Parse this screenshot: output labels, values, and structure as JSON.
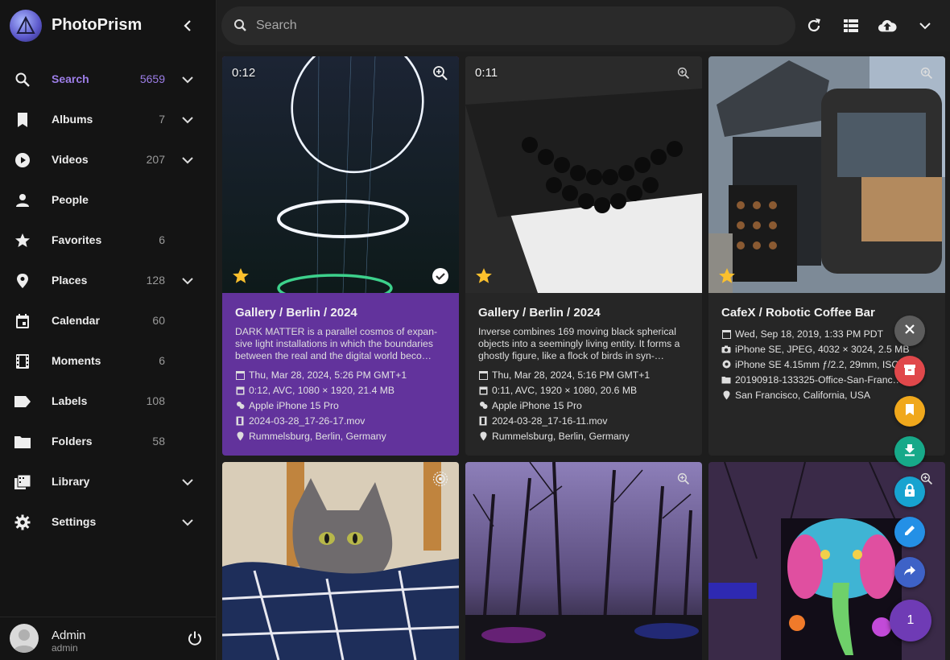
{
  "app": {
    "title": "PhotoPrism"
  },
  "sidebar": {
    "items": [
      {
        "label": "Search",
        "count": "5659",
        "icon": "search-icon",
        "expandable": true,
        "active": true
      },
      {
        "label": "Albums",
        "count": "7",
        "icon": "bookmark-icon",
        "expandable": true
      },
      {
        "label": "Videos",
        "count": "207",
        "icon": "play-circle-icon",
        "expandable": true
      },
      {
        "label": "People",
        "count": "",
        "icon": "person-icon",
        "expandable": false
      },
      {
        "label": "Favorites",
        "count": "6",
        "icon": "star-icon",
        "expandable": false
      },
      {
        "label": "Places",
        "count": "128",
        "icon": "map-marker-icon",
        "expandable": true
      },
      {
        "label": "Calendar",
        "count": "60",
        "icon": "calendar-icon",
        "expandable": false
      },
      {
        "label": "Moments",
        "count": "6",
        "icon": "film-icon",
        "expandable": false
      },
      {
        "label": "Labels",
        "count": "108",
        "icon": "label-icon",
        "expandable": false
      },
      {
        "label": "Folders",
        "count": "58",
        "icon": "folder-icon",
        "expandable": false
      },
      {
        "label": "Library",
        "count": "",
        "icon": "library-icon",
        "expandable": true
      },
      {
        "label": "Settings",
        "count": "",
        "icon": "gear-icon",
        "expandable": true
      }
    ]
  },
  "user": {
    "name": "Admin",
    "login": "admin"
  },
  "search": {
    "placeholder": "Search"
  },
  "toolbar": {
    "icons": [
      "refresh-icon",
      "list-view-icon",
      "upload-icon",
      "chevron-down-icon"
    ]
  },
  "cards": [
    {
      "duration": "0:12",
      "favorite": true,
      "selected": true,
      "title": "Gallery / Berlin / 2024",
      "description": "DARK MATTER is a parallel cosmos of expan-sive light installations in which the boundaries between the real and the digital world beco…",
      "meta": [
        {
          "icon": "calendar-icon",
          "text": "Thu, Mar 28, 2024, 5:26 PM GMT+1"
        },
        {
          "icon": "video-icon",
          "text": "0:12, AVC, 1080 × 1920, 21.4 MB"
        },
        {
          "icon": "camera-icon",
          "text": "Apple iPhone 15 Pro"
        },
        {
          "icon": "film-icon",
          "text": "2024-03-28_17-26-17.mov"
        },
        {
          "icon": "map-marker-icon",
          "text": "Rummelsburg, Berlin, Germany"
        }
      ]
    },
    {
      "duration": "0:11",
      "favorite": true,
      "selected": false,
      "title": "Gallery / Berlin / 2024",
      "description": "Inverse combines 169 moving black spherical objects into a seemingly living entity. It forms a ghostly figure, like a flock of birds in syn-…",
      "meta": [
        {
          "icon": "calendar-icon",
          "text": "Thu, Mar 28, 2024, 5:16 PM GMT+1"
        },
        {
          "icon": "video-icon",
          "text": "0:11, AVC, 1920 × 1080, 20.6 MB"
        },
        {
          "icon": "camera-icon",
          "text": "Apple iPhone 15 Pro"
        },
        {
          "icon": "film-icon",
          "text": "2024-03-28_17-16-11.mov"
        },
        {
          "icon": "map-marker-icon",
          "text": "Rummelsburg, Berlin, Germany"
        }
      ]
    },
    {
      "duration": "",
      "favorite": true,
      "selected": false,
      "title": "CafeX / Robotic Coffee Bar",
      "description": "",
      "meta": [
        {
          "icon": "calendar-icon",
          "text": "Wed, Sep 18, 2019, 1:33 PM PDT"
        },
        {
          "icon": "camera-icon",
          "text": "iPhone SE, JPEG, 4032 × 3024, 2.5 MB"
        },
        {
          "icon": "aperture-icon",
          "text": "iPhone SE 4.15mm ƒ/2.2, 29mm, ISO 2…"
        },
        {
          "icon": "folder-icon",
          "text": "20190918-133325-Office-San-Franc…"
        },
        {
          "icon": "map-marker-icon",
          "text": "San Francisco, California, USA"
        }
      ]
    }
  ],
  "selection": {
    "count": "1"
  },
  "fab_actions": [
    "close-icon",
    "archive-icon",
    "bookmark-icon",
    "download-icon",
    "lock-icon",
    "edit-icon",
    "share-icon"
  ],
  "colors": {
    "accent": "#9d7ee8",
    "selected_card": "#62339c",
    "archive": "#e0484b",
    "album": "#f0a81c",
    "download": "#17a989",
    "private": "#17a3d0",
    "edit": "#2490e6",
    "share": "#3e62c7"
  }
}
